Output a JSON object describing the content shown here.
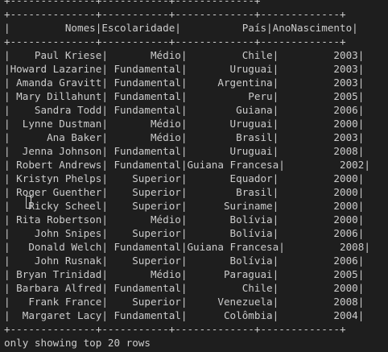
{
  "terminal": {
    "top_partial": "+--------------+-----------+-------------+",
    "separator": "+--------------+-----------+-------------+-------------+",
    "header": "|         Nomes|Escolaridade|          País|AnoNascimento|",
    "columns": [
      "Nomes",
      "Escolaridade",
      "País",
      "AnoNascimento"
    ],
    "rows": [
      "|    Paul Kriese|       Médio|         Chile|         2003|",
      "|Howard Lazarine| Fundamental|       Uruguai|         2003|",
      "| Amanda Gravitt| Fundamental|     Argentina|         2003|",
      "| Mary Dillahunt| Fundamental|          Peru|         2005|",
      "|    Sandra Todd| Fundamental|        Guiana|         2006|",
      "|  Lynne Dustman|       Médio|       Uruguai|         2000|",
      "|      Ana Baker|       Médio|        Brasil|         2003|",
      "|  Jenna Johnson| Fundamental|       Uruguai|         2008|",
      "| Robert Andrews| Fundamental|Guiana Francesa|         2002|",
      "| Kristyn Phelps|    Superior|       Equador|         2000|",
      "| Roger Guenther|    Superior|        Brasil|         2000|",
      "|   Ricky Scheel|    Superior|      Suriname|         2000|",
      "| Rita Robertson|       Médio|       Bolívia|         2000|",
      "|    John Snipes|    Superior|       Bolívia|         2006|",
      "|   Donald Welch| Fundamental|Guiana Francesa|         2008|",
      "|    John Rusnak|    Superior|       Bolívia|         2006|",
      "| Bryan Trinidad|       Médio|      Paraguai|         2005|",
      "| Barbara Alfred| Fundamental|         Chile|         2000|",
      "|   Frank France|    Superior|     Venezuela|         2008|",
      "|  Margaret Lacy| Fundamental|      Colômbia|         2004|"
    ],
    "footer": "only showing top 20 rows"
  }
}
